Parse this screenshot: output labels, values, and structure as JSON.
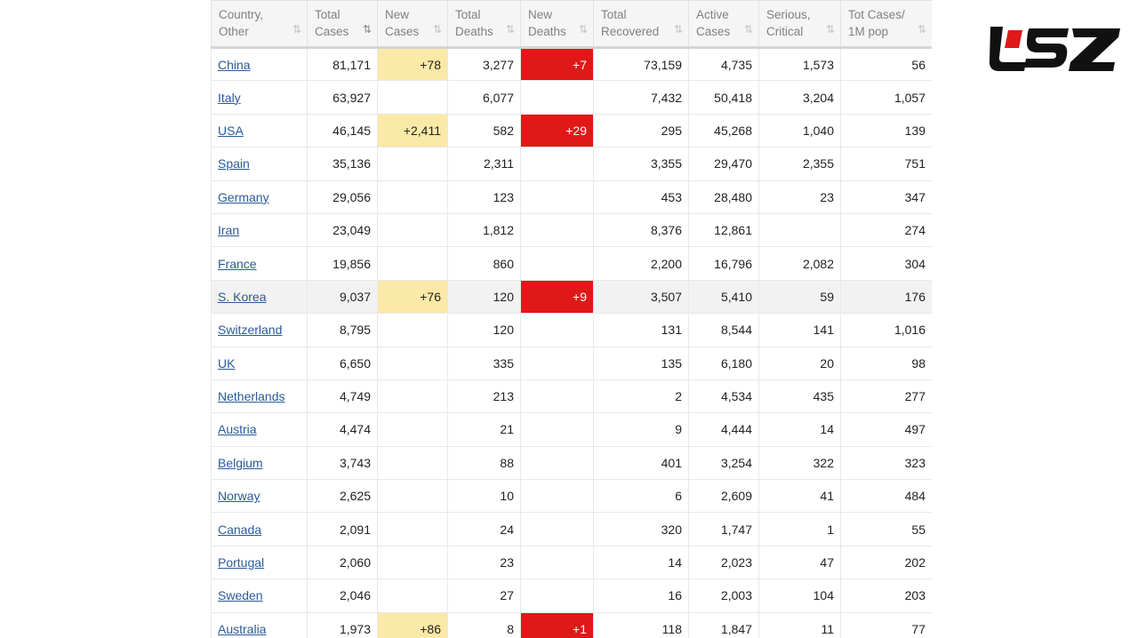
{
  "brand": {
    "logo_color": "#111111",
    "accent_color": "#e01818"
  },
  "colors": {
    "new_cases_highlight": "#fbe9a7",
    "new_deaths_highlight": "#e01818"
  },
  "headers": [
    {
      "line1": "Country,",
      "line2": "Other"
    },
    {
      "line1": "Total",
      "line2": "Cases"
    },
    {
      "line1": "New",
      "line2": "Cases"
    },
    {
      "line1": "Total",
      "line2": "Deaths"
    },
    {
      "line1": "New",
      "line2": "Deaths"
    },
    {
      "line1": "Total",
      "line2": "Recovered"
    },
    {
      "line1": "Active",
      "line2": "Cases"
    },
    {
      "line1": "Serious,",
      "line2": "Critical"
    },
    {
      "line1": "Tot Cases/",
      "line2": "1M pop"
    }
  ],
  "sort_icon": "sort-icon",
  "rows": [
    {
      "country": "China",
      "total_cases": "81,171",
      "new_cases": "+78",
      "total_deaths": "3,277",
      "new_deaths": "+7",
      "total_recovered": "73,159",
      "active_cases": "4,735",
      "serious_critical": "1,573",
      "per_1m": "56"
    },
    {
      "country": "Italy",
      "total_cases": "63,927",
      "new_cases": "",
      "total_deaths": "6,077",
      "new_deaths": "",
      "total_recovered": "7,432",
      "active_cases": "50,418",
      "serious_critical": "3,204",
      "per_1m": "1,057"
    },
    {
      "country": "USA",
      "total_cases": "46,145",
      "new_cases": "+2,411",
      "total_deaths": "582",
      "new_deaths": "+29",
      "total_recovered": "295",
      "active_cases": "45,268",
      "serious_critical": "1,040",
      "per_1m": "139"
    },
    {
      "country": "Spain",
      "total_cases": "35,136",
      "new_cases": "",
      "total_deaths": "2,311",
      "new_deaths": "",
      "total_recovered": "3,355",
      "active_cases": "29,470",
      "serious_critical": "2,355",
      "per_1m": "751"
    },
    {
      "country": "Germany",
      "total_cases": "29,056",
      "new_cases": "",
      "total_deaths": "123",
      "new_deaths": "",
      "total_recovered": "453",
      "active_cases": "28,480",
      "serious_critical": "23",
      "per_1m": "347"
    },
    {
      "country": "Iran",
      "total_cases": "23,049",
      "new_cases": "",
      "total_deaths": "1,812",
      "new_deaths": "",
      "total_recovered": "8,376",
      "active_cases": "12,861",
      "serious_critical": "",
      "per_1m": "274"
    },
    {
      "country": "France",
      "total_cases": "19,856",
      "new_cases": "",
      "total_deaths": "860",
      "new_deaths": "",
      "total_recovered": "2,200",
      "active_cases": "16,796",
      "serious_critical": "2,082",
      "per_1m": "304"
    },
    {
      "country": "S. Korea",
      "total_cases": "9,037",
      "new_cases": "+76",
      "total_deaths": "120",
      "new_deaths": "+9",
      "total_recovered": "3,507",
      "active_cases": "5,410",
      "serious_critical": "59",
      "per_1m": "176",
      "highlight": true
    },
    {
      "country": "Switzerland",
      "total_cases": "8,795",
      "new_cases": "",
      "total_deaths": "120",
      "new_deaths": "",
      "total_recovered": "131",
      "active_cases": "8,544",
      "serious_critical": "141",
      "per_1m": "1,016"
    },
    {
      "country": "UK",
      "total_cases": "6,650",
      "new_cases": "",
      "total_deaths": "335",
      "new_deaths": "",
      "total_recovered": "135",
      "active_cases": "6,180",
      "serious_critical": "20",
      "per_1m": "98"
    },
    {
      "country": "Netherlands",
      "total_cases": "4,749",
      "new_cases": "",
      "total_deaths": "213",
      "new_deaths": "",
      "total_recovered": "2",
      "active_cases": "4,534",
      "serious_critical": "435",
      "per_1m": "277"
    },
    {
      "country": "Austria",
      "total_cases": "4,474",
      "new_cases": "",
      "total_deaths": "21",
      "new_deaths": "",
      "total_recovered": "9",
      "active_cases": "4,444",
      "serious_critical": "14",
      "per_1m": "497"
    },
    {
      "country": "Belgium",
      "total_cases": "3,743",
      "new_cases": "",
      "total_deaths": "88",
      "new_deaths": "",
      "total_recovered": "401",
      "active_cases": "3,254",
      "serious_critical": "322",
      "per_1m": "323"
    },
    {
      "country": "Norway",
      "total_cases": "2,625",
      "new_cases": "",
      "total_deaths": "10",
      "new_deaths": "",
      "total_recovered": "6",
      "active_cases": "2,609",
      "serious_critical": "41",
      "per_1m": "484"
    },
    {
      "country": "Canada",
      "total_cases": "2,091",
      "new_cases": "",
      "total_deaths": "24",
      "new_deaths": "",
      "total_recovered": "320",
      "active_cases": "1,747",
      "serious_critical": "1",
      "per_1m": "55"
    },
    {
      "country": "Portugal",
      "total_cases": "2,060",
      "new_cases": "",
      "total_deaths": "23",
      "new_deaths": "",
      "total_recovered": "14",
      "active_cases": "2,023",
      "serious_critical": "47",
      "per_1m": "202"
    },
    {
      "country": "Sweden",
      "total_cases": "2,046",
      "new_cases": "",
      "total_deaths": "27",
      "new_deaths": "",
      "total_recovered": "16",
      "active_cases": "2,003",
      "serious_critical": "104",
      "per_1m": "203"
    },
    {
      "country": "Australia",
      "total_cases": "1,973",
      "new_cases": "+86",
      "total_deaths": "8",
      "new_deaths": "+1",
      "total_recovered": "118",
      "active_cases": "1,847",
      "serious_critical": "11",
      "per_1m": "77"
    }
  ]
}
